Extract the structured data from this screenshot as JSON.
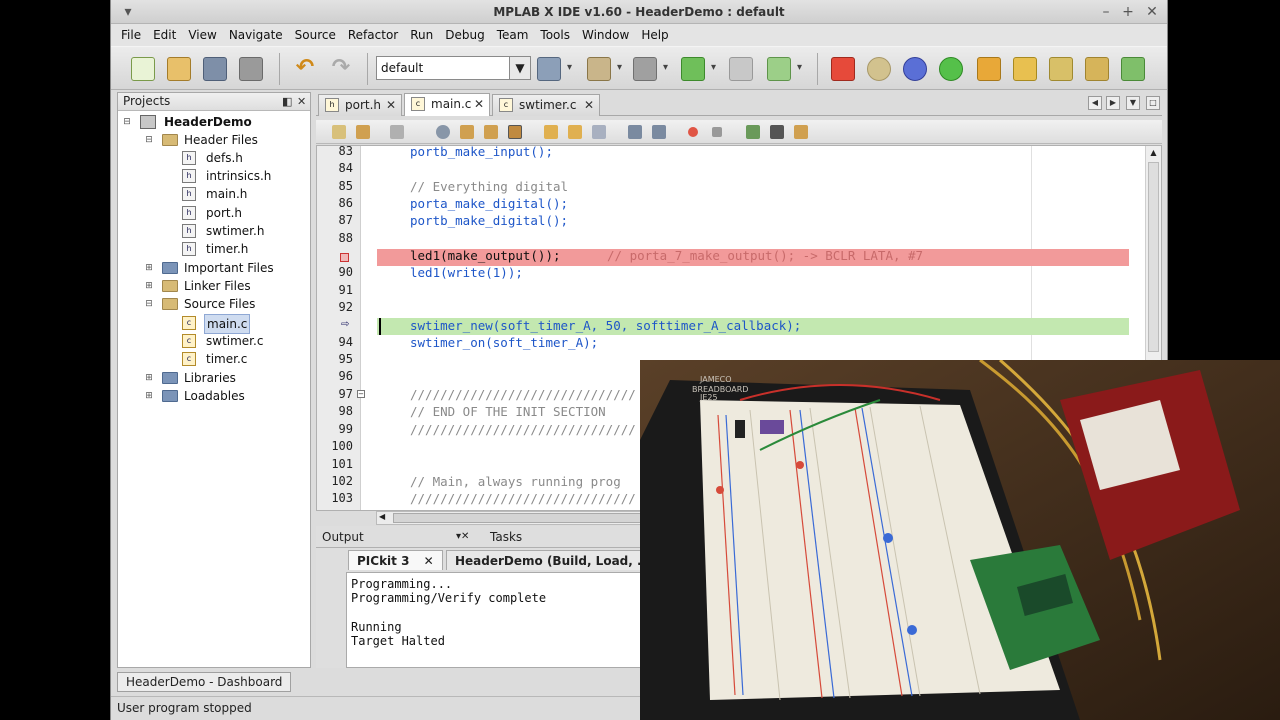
{
  "window": {
    "title": "MPLAB X IDE v1.60 - HeaderDemo : default"
  },
  "menu": [
    "File",
    "Edit",
    "View",
    "Navigate",
    "Source",
    "Refactor",
    "Run",
    "Debug",
    "Team",
    "Tools",
    "Window",
    "Help"
  ],
  "toolbar": {
    "configuration": "default"
  },
  "projects": {
    "title": "Projects",
    "root": "HeaderDemo",
    "items": [
      {
        "label": "Header Files"
      },
      {
        "label": "defs.h"
      },
      {
        "label": "intrinsics.h"
      },
      {
        "label": "main.h"
      },
      {
        "label": "port.h"
      },
      {
        "label": "swtimer.h"
      },
      {
        "label": "timer.h"
      },
      {
        "label": "Important Files"
      },
      {
        "label": "Linker Files"
      },
      {
        "label": "Source Files"
      },
      {
        "label": "main.c"
      },
      {
        "label": "swtimer.c"
      },
      {
        "label": "timer.c"
      },
      {
        "label": "Libraries"
      },
      {
        "label": "Loadables"
      }
    ]
  },
  "editor": {
    "tabs": [
      "port.h",
      "main.c",
      "swtimer.c"
    ],
    "active_tab": "main.c",
    "lines": [
      {
        "num": "83",
        "code": "portb_make_input();"
      },
      {
        "num": "84",
        "code": ""
      },
      {
        "num": "85",
        "code": "// Everything digital"
      },
      {
        "num": "86",
        "code": "porta_make_digital();"
      },
      {
        "num": "87",
        "code": "portb_make_digital();"
      },
      {
        "num": "88",
        "code": ""
      },
      {
        "num": "",
        "code": "led1(make_output());",
        "comment": "// porta_7_make_output(); -> BCLR LATA, #7",
        "breakpoint": true
      },
      {
        "num": "90",
        "code": "led1(write(1));"
      },
      {
        "num": "91",
        "code": ""
      },
      {
        "num": "92",
        "code": ""
      },
      {
        "num": "",
        "code": "swtimer_new(soft_timer_A, 50, softtimer_A_callback);",
        "pc": true
      },
      {
        "num": "94",
        "code": "swtimer_on(soft_timer_A);"
      },
      {
        "num": "95",
        "code": ""
      },
      {
        "num": "96",
        "code": ""
      },
      {
        "num": "97",
        "code": "//////////////////////////////"
      },
      {
        "num": "98",
        "code": "// END OF THE INIT SECTION"
      },
      {
        "num": "99",
        "code": "//////////////////////////////"
      },
      {
        "num": "100",
        "code": ""
      },
      {
        "num": "101",
        "code": ""
      },
      {
        "num": "102",
        "code": "// Main, always running prog"
      },
      {
        "num": "103",
        "code": "//////////////////////////////"
      }
    ]
  },
  "output": {
    "title": "Output",
    "tasks": "Tasks",
    "subtabs": [
      "PICkit 3",
      "HeaderDemo (Build, Load, ..."
    ],
    "lines": [
      "Programming...",
      "Programming/Verify complete",
      "",
      "Running",
      "Target Halted"
    ]
  },
  "dashboard": {
    "label": "HeaderDemo - Dashboard"
  },
  "status": {
    "text": "User program stopped"
  },
  "photo": {
    "board_label": "JAMECO",
    "board_sub": "BREADBOARD",
    "board_brand": "JE25"
  }
}
